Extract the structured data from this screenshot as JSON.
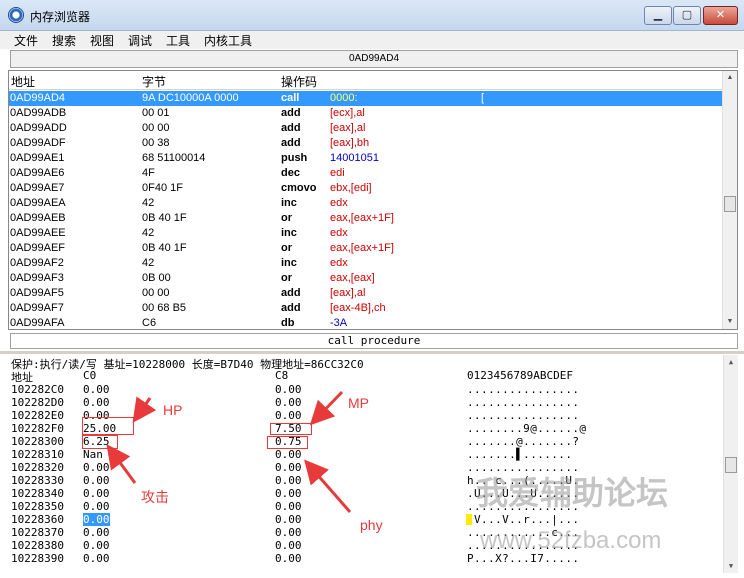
{
  "window": {
    "title": "内存浏览器",
    "min_glyph": "▁",
    "max_glyph": "▢",
    "close_glyph": "✕"
  },
  "menu": [
    "文件",
    "搜索",
    "视图",
    "调试",
    "工具",
    "内核工具"
  ],
  "disassembler": {
    "address_bar": "0AD99AD4",
    "headers": {
      "address": "地址",
      "bytes": "字节",
      "opcode": "操作码"
    },
    "selected_extra": "[",
    "rows": [
      {
        "addr": "0AD99AD4",
        "bytes": "9A DC10000A 0000",
        "op": "call",
        "arg": "0000:",
        "argc": "red",
        "sel": true
      },
      {
        "addr": "0AD99ADB",
        "bytes": "00 01",
        "op": "add",
        "arg": "[ecx],al",
        "argc": "red"
      },
      {
        "addr": "0AD99ADD",
        "bytes": "00 00",
        "op": "add",
        "arg": "[eax],al",
        "argc": "red"
      },
      {
        "addr": "0AD99ADF",
        "bytes": "00 38",
        "op": "add",
        "arg": "[eax],bh",
        "argc": "red"
      },
      {
        "addr": "0AD99AE1",
        "bytes": "68 51100014",
        "op": "push",
        "arg": "14001051",
        "argc": "blue"
      },
      {
        "addr": "0AD99AE6",
        "bytes": "4F",
        "op": "dec",
        "arg": "edi",
        "argc": "red"
      },
      {
        "addr": "0AD99AE7",
        "bytes": "0F40 1F",
        "op": "cmovo",
        "arg": "ebx,[edi]",
        "argc": "red"
      },
      {
        "addr": "0AD99AEA",
        "bytes": "42",
        "op": "inc",
        "arg": "edx",
        "argc": "red"
      },
      {
        "addr": "0AD99AEB",
        "bytes": "0B 40 1F",
        "op": "or",
        "arg": "eax,[eax+1F]",
        "argc": "red"
      },
      {
        "addr": "0AD99AEE",
        "bytes": "42",
        "op": "inc",
        "arg": "edx",
        "argc": "red"
      },
      {
        "addr": "0AD99AEF",
        "bytes": "0B 40 1F",
        "op": "or",
        "arg": "eax,[eax+1F]",
        "argc": "red"
      },
      {
        "addr": "0AD99AF2",
        "bytes": "42",
        "op": "inc",
        "arg": "edx",
        "argc": "red"
      },
      {
        "addr": "0AD99AF3",
        "bytes": "0B 00",
        "op": "or",
        "arg": "eax,[eax]",
        "argc": "red"
      },
      {
        "addr": "0AD99AF5",
        "bytes": "00 00",
        "op": "add",
        "arg": "[eax],al",
        "argc": "red"
      },
      {
        "addr": "0AD99AF7",
        "bytes": "00 68 B5",
        "op": "add",
        "arg": "[eax-4B],ch",
        "argc": "red"
      },
      {
        "addr": "0AD99AFA",
        "bytes": "C6",
        "op": "db",
        "arg": "-3A",
        "argc": "blue"
      }
    ]
  },
  "procedure_label": "call procedure",
  "memory": {
    "info": "保护:执行/读/写  基址=10228000 长度=B7D40 物理地址=86CC32C0",
    "headers": {
      "address": "地址",
      "c0": "C0",
      "c8": "C8",
      "ascii": "0123456789ABCDEF"
    },
    "rows": [
      {
        "addr": "102282C0",
        "c0": "0.00",
        "c8": "0.00",
        "ascii": "................"
      },
      {
        "addr": "102282D0",
        "c0": "0.00",
        "c8": "0.00",
        "ascii": "................"
      },
      {
        "addr": "102282E0",
        "c0": "0.00",
        "c8": "0.00",
        "ascii": "................"
      },
      {
        "addr": "102282F0",
        "c0": "25.00",
        "c8": "7.50",
        "ascii": "........9@......@"
      },
      {
        "addr": "10228300",
        "c0": "6.25",
        "c8": "0.75",
        "ascii": ".......@.......?"
      },
      {
        "addr": "10228310",
        "c0": "Nan",
        "c8": "0.00",
        "ascii": ".......▌......."
      },
      {
        "addr": "10228320",
        "c0": "0.00",
        "c8": "0.00",
        "ascii": "................"
      },
      {
        "addr": "10228330",
        "c0": "0.00",
        "c8": "0.00",
        "ascii": "h.. c...(.....U."
      },
      {
        "addr": "10228340",
        "c0": "0.00",
        "c8": "0.00",
        "ascii": ".U...U...U......"
      },
      {
        "addr": "10228350",
        "c0": "0.00",
        "c8": "0.00",
        "ascii": "................"
      },
      {
        "addr": "10228360",
        "c0": "0.00",
        "c8": "0.00",
        "ascii": ".V...V..r...|..."
      },
      {
        "addr": "10228370",
        "c0": "0.00",
        "c8": "0.00",
        "ascii": "............c..."
      },
      {
        "addr": "10228380",
        "c0": "0.00",
        "c8": "0.00",
        "ascii": "................"
      },
      {
        "addr": "10228390",
        "c0": "0.00",
        "c8": "0.00",
        "ascii": "P...X?...I7....."
      }
    ],
    "highlight_row": 10
  },
  "annotations": {
    "hp": "HP",
    "mp": "MP",
    "attack": "攻击",
    "phy": "phy",
    "color": "#e83a3a"
  },
  "watermark": {
    "main": "我爱辅助论坛",
    "url": "www.52fzba.com"
  }
}
